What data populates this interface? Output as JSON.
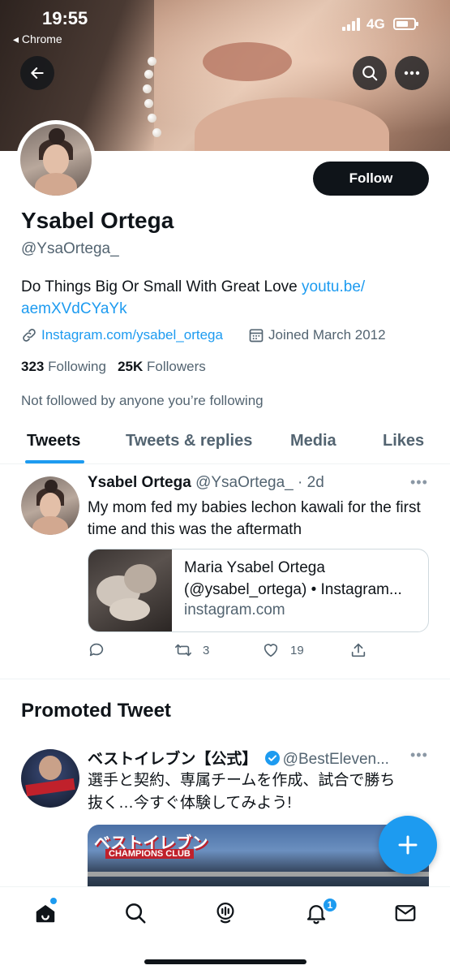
{
  "status_bar": {
    "time": "19:55",
    "back_app": "◂ Chrome",
    "network": "4G"
  },
  "profile": {
    "name": "Ysabel Ortega",
    "handle": "@YsaOrtega_",
    "bio_text": "Do Things Big Or Small With Great Love ",
    "bio_link_1": "youtu.be/",
    "bio_link_2": "aemXVdCYaYk",
    "website": "Instagram.com/ysabel_ortega",
    "joined": "Joined March 2012",
    "following_count": "323",
    "following_label": "Following",
    "followers_count": "25K",
    "followers_label": "Followers",
    "social_context": "Not followed by anyone you’re following",
    "follow_label": "Follow"
  },
  "tabs": [
    {
      "label": "Tweets",
      "active": true
    },
    {
      "label": "Tweets & replies",
      "active": false
    },
    {
      "label": "Media",
      "active": false
    },
    {
      "label": "Likes",
      "active": false
    }
  ],
  "tweet": {
    "author_name": "Ysabel Ortega",
    "author_handle": "@YsaOrtega_",
    "time": "· 2d",
    "text": "My mom fed my babies lechon kawali for the first time and this was the aftermath",
    "card_title_1": "Maria Ysabel Ortega",
    "card_title_2": "(@ysabel_ortega) • Instagram...",
    "card_domain": "instagram.com",
    "retweets": "3",
    "likes": "19"
  },
  "promoted": {
    "section_title": "Promoted Tweet",
    "author_name": "ベストイレブン【公式】",
    "author_handle": "@BestEleven...",
    "text_line_1": "選手と契約、専属チームを作成、試合で勝ち",
    "text_line_2": "抜く…今すぐ体験してみよう!",
    "media_logo": "ベストイレブン",
    "media_sub": "CHAMPIONS CLUB"
  },
  "nav": {
    "notifications_badge": "1"
  },
  "colors": {
    "accent": "#1d9bf0",
    "text": "#0f1419",
    "muted": "#536471"
  },
  "icons": [
    "back-arrow-icon",
    "search-icon",
    "more-icon",
    "link-icon",
    "calendar-icon",
    "reply-icon",
    "retweet-icon",
    "like-icon",
    "share-icon",
    "verified-icon",
    "compose-plus-icon",
    "home-icon",
    "spaces-icon",
    "bell-icon",
    "mail-icon"
  ]
}
